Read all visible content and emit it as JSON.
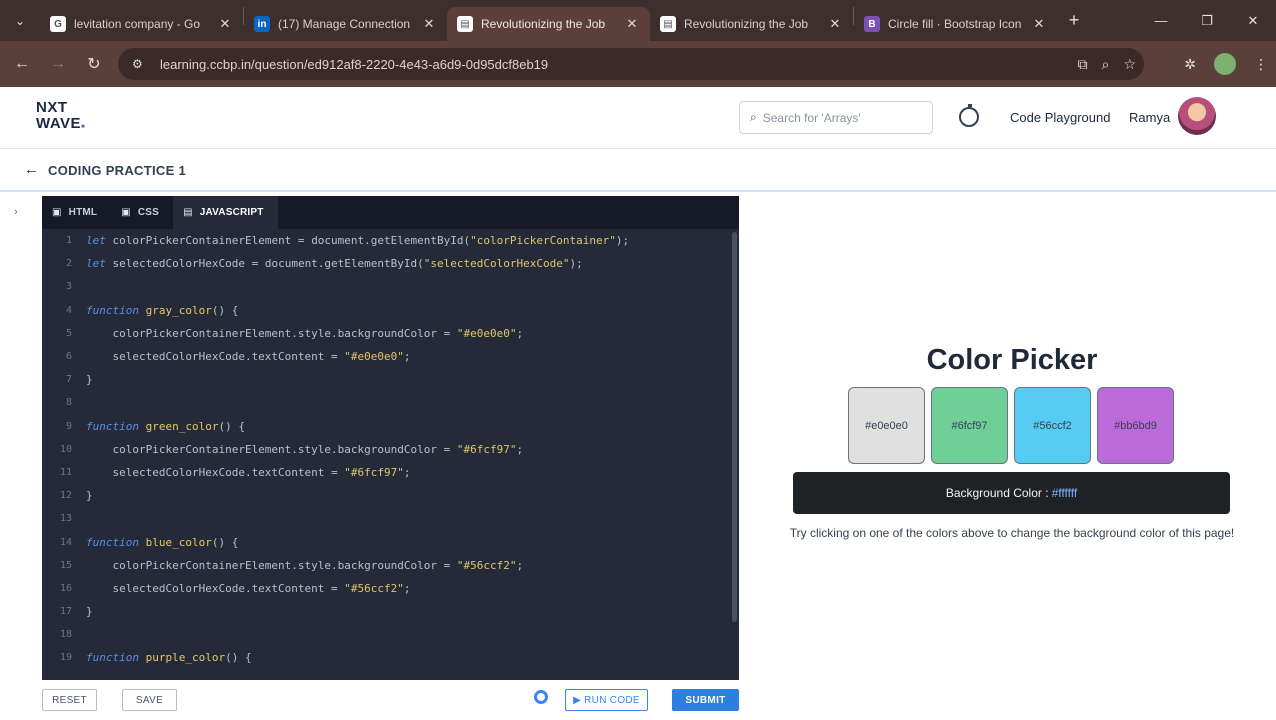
{
  "browser": {
    "tabs": [
      {
        "title": "levitation company - Go",
        "fav": "G",
        "color": "#ffffff"
      },
      {
        "title": "(17) Manage Connection",
        "fav": "in",
        "color": "#0a66c2"
      },
      {
        "title": "Revolutionizing the Job",
        "fav": "▤",
        "color": "#ffffff"
      },
      {
        "title": "Revolutionizing the Job",
        "fav": "▤",
        "color": "#ffffff"
      },
      {
        "title": "Circle fill · Bootstrap Icon",
        "fav": "B",
        "color": "#7952b3"
      }
    ],
    "url": "learning.ccbp.in/question/ed912af8-2220-4e43-a6d9-0d95dcf8eb19"
  },
  "header": {
    "logo_top": "NXT",
    "logo_bottom": "WAVE",
    "search_placeholder": "Search for 'Arrays'",
    "code_playground": "Code Playground",
    "user_name": "Ramya"
  },
  "breadcrumb": {
    "title": "CODING PRACTICE 1"
  },
  "editor": {
    "tabs": [
      "HTML",
      "CSS",
      "JAVASCRIPT"
    ],
    "lines": [
      {
        "n": "1",
        "t": [
          [
            "kw",
            "let "
          ],
          [
            "",
            "colorPickerContainerElement = "
          ],
          [
            "",
            "document.getElementById("
          ],
          [
            "str",
            "\"colorPickerContainer\""
          ],
          [
            "",
            ");"
          ]
        ]
      },
      {
        "n": "2",
        "t": [
          [
            "kw",
            "let "
          ],
          [
            "",
            "selectedColorHexCode = "
          ],
          [
            "",
            "document.getElementById("
          ],
          [
            "str",
            "\"selectedColorHexCode\""
          ],
          [
            "",
            ");"
          ]
        ]
      },
      {
        "n": "3",
        "t": []
      },
      {
        "n": "4",
        "t": [
          [
            "kw",
            "function "
          ],
          [
            "fn",
            "gray_color"
          ],
          [
            "",
            "() {"
          ]
        ]
      },
      {
        "n": "5",
        "t": [
          [
            "",
            "    colorPickerContainerElement.style.backgroundColor = "
          ],
          [
            "str",
            "\"#e0e0e0\""
          ],
          [
            "",
            ";"
          ]
        ]
      },
      {
        "n": "6",
        "t": [
          [
            "",
            "    selectedColorHexCode.textContent = "
          ],
          [
            "str",
            "\"#e0e0e0\""
          ],
          [
            "",
            ";"
          ]
        ]
      },
      {
        "n": "7",
        "t": [
          [
            "",
            "}"
          ]
        ]
      },
      {
        "n": "8",
        "t": []
      },
      {
        "n": "9",
        "t": [
          [
            "kw",
            "function "
          ],
          [
            "fn",
            "green_color"
          ],
          [
            "",
            "() {"
          ]
        ]
      },
      {
        "n": "10",
        "t": [
          [
            "",
            "    colorPickerContainerElement.style.backgroundColor = "
          ],
          [
            "str",
            "\"#6fcf97\""
          ],
          [
            "",
            ";"
          ]
        ]
      },
      {
        "n": "11",
        "t": [
          [
            "",
            "    selectedColorHexCode.textContent = "
          ],
          [
            "str",
            "\"#6fcf97\""
          ],
          [
            "",
            ";"
          ]
        ]
      },
      {
        "n": "12",
        "t": [
          [
            "",
            "}"
          ]
        ]
      },
      {
        "n": "13",
        "t": []
      },
      {
        "n": "14",
        "t": [
          [
            "kw",
            "function "
          ],
          [
            "fn",
            "blue_color"
          ],
          [
            "",
            "() {"
          ]
        ]
      },
      {
        "n": "15",
        "t": [
          [
            "",
            "    colorPickerContainerElement.style.backgroundColor = "
          ],
          [
            "str",
            "\"#56ccf2\""
          ],
          [
            "",
            ";"
          ]
        ]
      },
      {
        "n": "16",
        "t": [
          [
            "",
            "    selectedColorHexCode.textContent = "
          ],
          [
            "str",
            "\"#56ccf2\""
          ],
          [
            "",
            ";"
          ]
        ]
      },
      {
        "n": "17",
        "t": [
          [
            "",
            "}"
          ]
        ]
      },
      {
        "n": "18",
        "t": []
      },
      {
        "n": "19",
        "t": [
          [
            "kw",
            "function "
          ],
          [
            "fn",
            "purple_color"
          ],
          [
            "",
            "() {"
          ]
        ]
      }
    ]
  },
  "actions": {
    "reset": "RESET",
    "save": "SAVE",
    "run": "▶ RUN CODE",
    "submit": "SUBMIT"
  },
  "preview": {
    "title": "Color Picker",
    "swatches": [
      {
        "label": "#e0e0e0",
        "color": "#e0e0e0"
      },
      {
        "label": "#6fcf97",
        "color": "#6fcf97"
      },
      {
        "label": "#56ccf2",
        "color": "#56ccf2"
      },
      {
        "label": "#bb6bd9",
        "color": "#bb6bd9"
      }
    ],
    "bg_label": "Background Color :",
    "bg_value": "#ffffff",
    "hint": "Try clicking on one of the colors above to change the background color of this page!"
  }
}
